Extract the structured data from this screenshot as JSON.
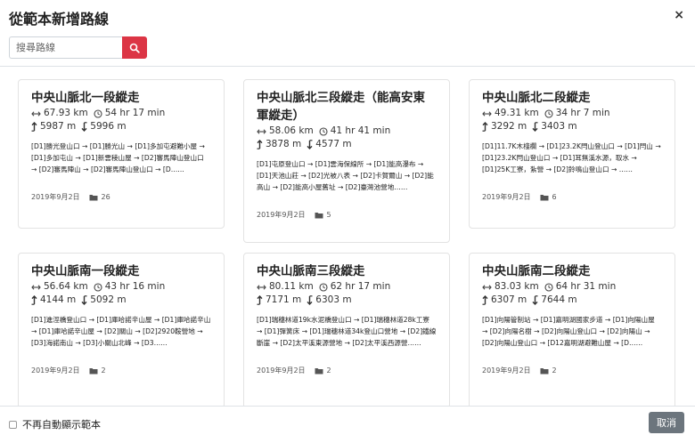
{
  "modal": {
    "title": "從範本新增路線",
    "close_symbol": "×"
  },
  "search": {
    "placeholder": "搜尋路線",
    "value": ""
  },
  "cards": [
    {
      "title": "中央山脈北一段縱走",
      "distance": "67.93 km",
      "time": "54 hr 17 min",
      "ascent": "5987 m",
      "descent": "5996 m",
      "description": "[D1]勝光登山口 → [D1]勝光山 → [D1]多加屯避難小屋 → [D1]多加屯山 → [D1]新雲稜山屋 → [D2]審馬陣山登山口 → [D2]審馬陣山 → [D2]審馬陣山登山口 → [D……",
      "date": "2019年9月2日",
      "count": "26"
    },
    {
      "title": "中央山脈北三段縱走（能高安東軍縱走）",
      "distance": "58.06 km",
      "time": "41 hr 41 min",
      "ascent": "3878 m",
      "descent": "4577 m",
      "description": "[D1]屯原登山口 → [D1]雲海保線所 → [D1]能高瀑布 → [D1]天池山莊 → [D2]光被八表 → [D2]卡賀爾山 → [D2]能高山 → [D2]能高小屋舊址 → [D2]臺灣池營地……",
      "date": "2019年9月2日",
      "count": "5"
    },
    {
      "title": "中央山脈北二段縱走",
      "distance": "49.31 km",
      "time": "34 hr 7 min",
      "ascent": "3292 m",
      "descent": "3403 m",
      "description": "[D1]11.7K木棧欄 → [D1]23.2K閂山登山口 → [D1]閂山 → [D1]23.2K閂山登山口 → [D1]耳無溪水源，取水 → [D1]25K工寮，紮營 → [D2]鈴鳴山登山口 → ……",
      "date": "2019年9月2日",
      "count": "6"
    },
    {
      "title": "中央山脈南一段縱走",
      "distance": "56.64 km",
      "time": "43 hr 16 min",
      "ascent": "4144 m",
      "descent": "5092 m",
      "description": "[D1]進涇橋登山口 → [D1]庫哈諾辛山屋 → [D1]庫哈諾辛山 → [D1]庫哈諾辛山屋 → [D2]關山 → [D2]2920鞍營地 → [D3]海諾南山 → [D3]小關山北峰 → [D3……",
      "date": "2019年9月2日",
      "count": "2"
    },
    {
      "title": "中央山脈南三段縱走",
      "distance": "80.11 km",
      "time": "62 hr 17 min",
      "ascent": "7171 m",
      "descent": "6303 m",
      "description": "[D1]瑞穗林道19k水泥橋登山口 → [D1]瑞穗林道28k工寮 → [D1]彈簧床 → [D1]瑞穗林道34k登山口營地 → [D2]鐵線斷崖 → [D2]太平溪東源營地 → [D2]太平溪西源營……",
      "date": "2019年9月2日",
      "count": "2"
    },
    {
      "title": "中央山脈南二段縱走",
      "distance": "83.03 km",
      "time": "64 hr 31 min",
      "ascent": "6307 m",
      "descent": "7644 m",
      "description": "[D1]向陽管制站 → [D1]嘉明湖國家步道 → [D1]向陽山屋 → [D2]向陽名樹 → [D2]向陽山登山口 → [D2]向陽山 → [D2]向陽山登山口 → [D12嘉明湖避難山屋 → [D……",
      "date": "2019年9月2日",
      "count": "2"
    }
  ],
  "footer": {
    "checkbox_label": "不再自動顯示範本",
    "cancel_label": "取消"
  },
  "colors": {
    "search_button": "#dc3545",
    "cancel_button": "#6c757d",
    "border": "#dee2e6"
  },
  "icons": {
    "search": "search-icon",
    "distance": "arrows-horizontal-icon",
    "time": "clock-icon",
    "ascent": "ascent-arrow-icon",
    "descent": "descent-arrow-icon",
    "folder": "folder-icon"
  }
}
